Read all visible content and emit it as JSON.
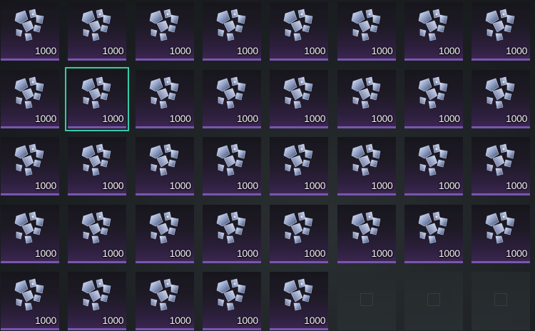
{
  "inventory": {
    "item_icon": "crystal-shards-icon",
    "selected_index": 9,
    "slots": [
      {
        "qty": "1000"
      },
      {
        "qty": "1000"
      },
      {
        "qty": "1000"
      },
      {
        "qty": "1000"
      },
      {
        "qty": "1000"
      },
      {
        "qty": "1000"
      },
      {
        "qty": "1000"
      },
      {
        "qty": "1000"
      },
      {
        "qty": "1000"
      },
      {
        "qty": "1000"
      },
      {
        "qty": "1000"
      },
      {
        "qty": "1000"
      },
      {
        "qty": "1000"
      },
      {
        "qty": "1000"
      },
      {
        "qty": "1000"
      },
      {
        "qty": "1000"
      },
      {
        "qty": "1000"
      },
      {
        "qty": "1000"
      },
      {
        "qty": "1000"
      },
      {
        "qty": "1000"
      },
      {
        "qty": "1000"
      },
      {
        "qty": "1000"
      },
      {
        "qty": "1000"
      },
      {
        "qty": "1000"
      },
      {
        "qty": "1000"
      },
      {
        "qty": "1000"
      },
      {
        "qty": "1000"
      },
      {
        "qty": "1000"
      },
      {
        "qty": "1000"
      },
      {
        "qty": "1000"
      },
      {
        "qty": "1000"
      },
      {
        "qty": "1000"
      },
      {
        "qty": "1000"
      },
      {
        "qty": "1000"
      },
      {
        "qty": "1000"
      },
      {
        "qty": "1000"
      },
      {
        "qty": "1000"
      },
      {
        "qty": null
      },
      {
        "qty": null
      },
      {
        "qty": null
      }
    ]
  },
  "colors": {
    "slot_accent": "#7a55b0",
    "selection": "#38c9a8"
  }
}
